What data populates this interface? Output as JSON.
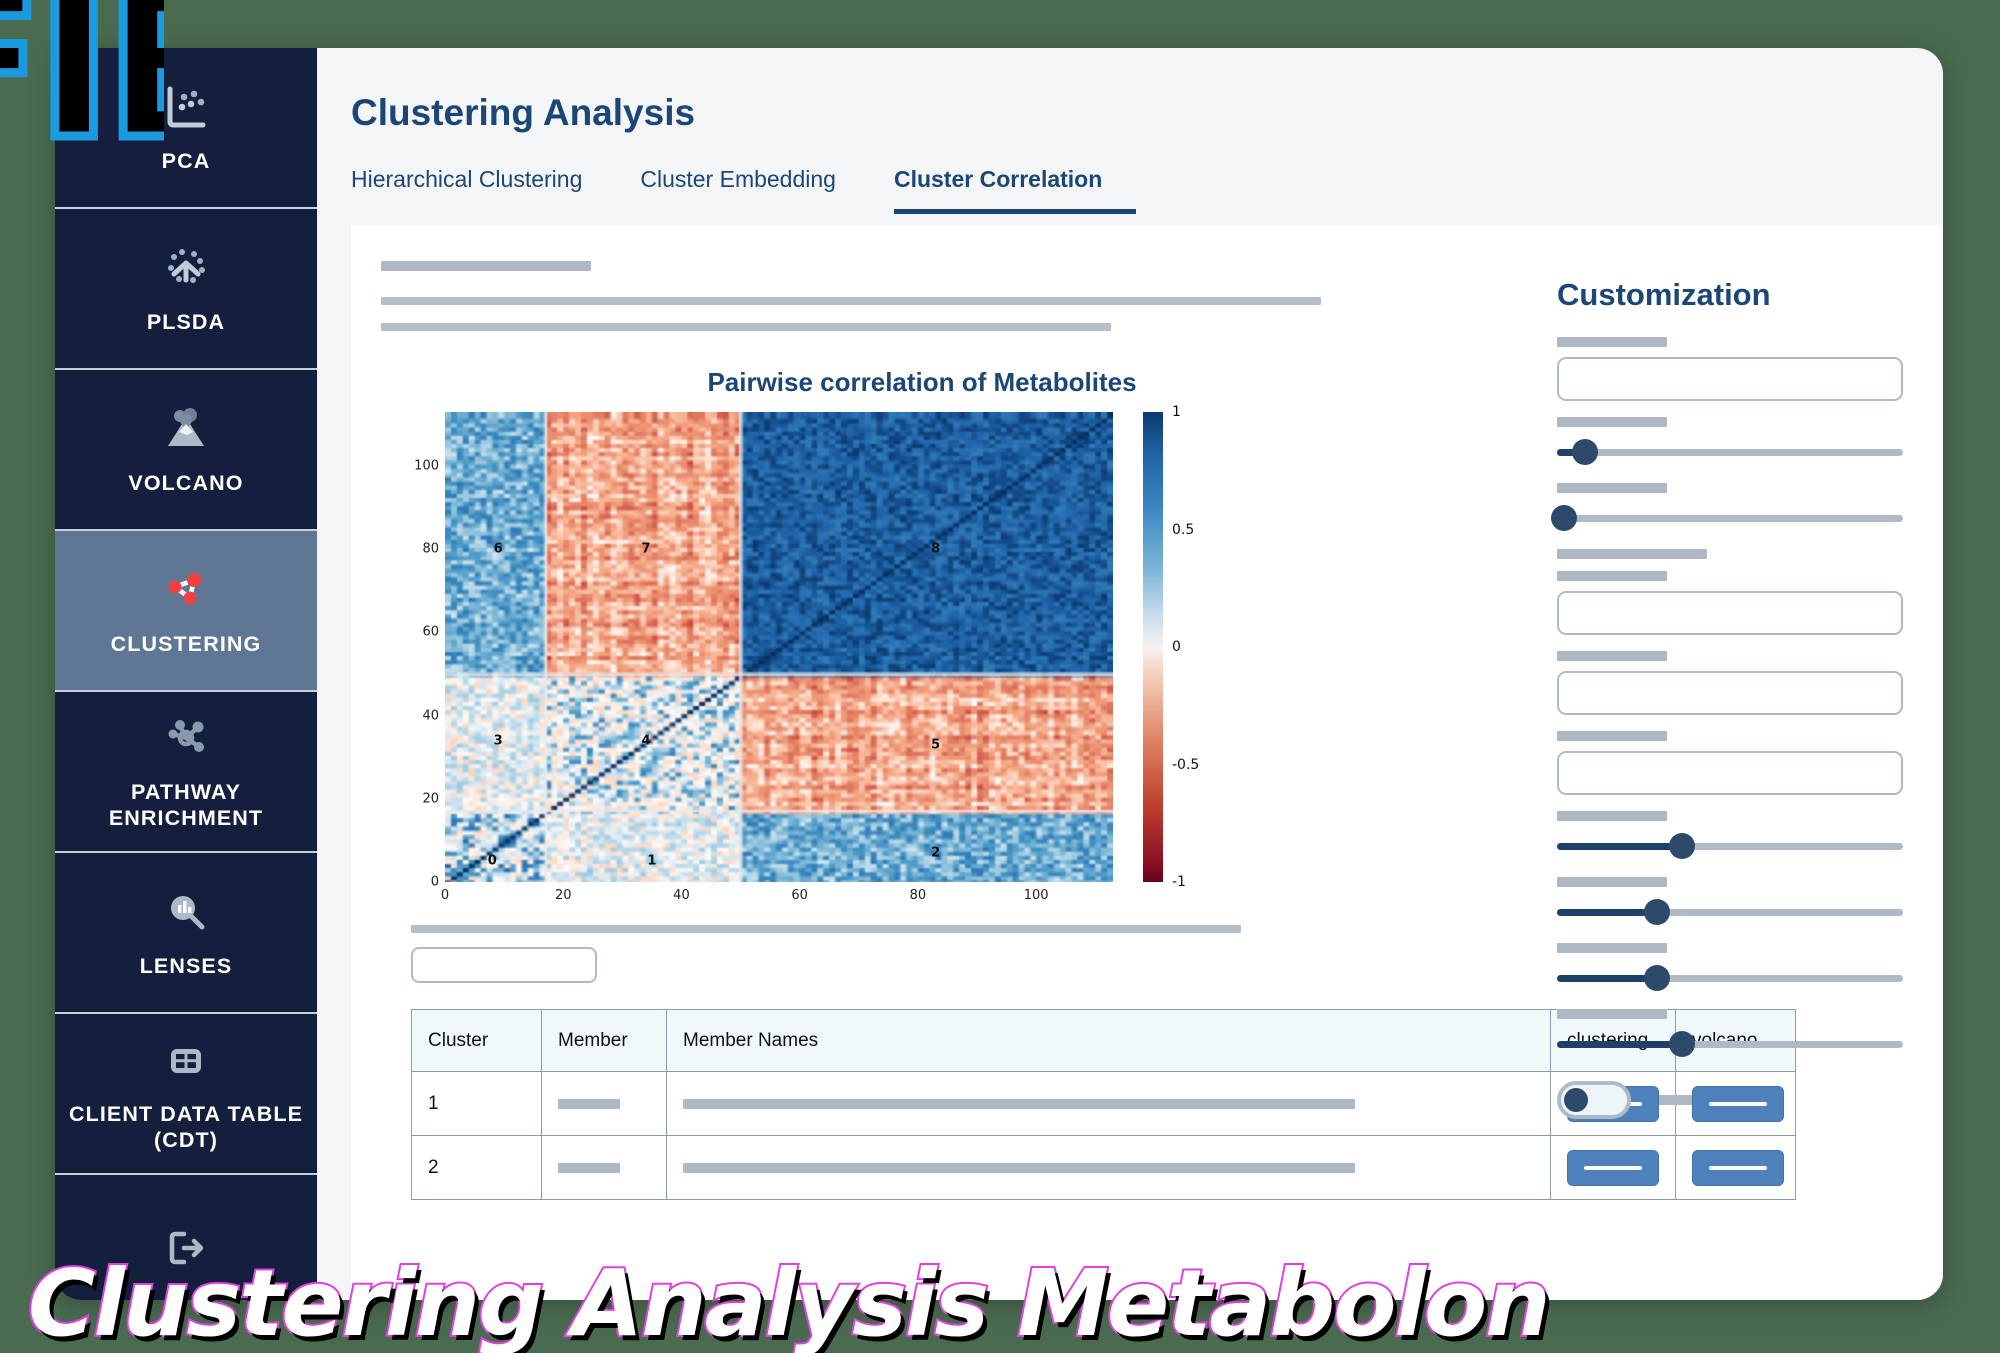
{
  "overlay": {
    "edge_text": "FIELD",
    "bottom_text": "Clustering Analysis Metabolon"
  },
  "sidebar": {
    "items": [
      {
        "label": "PCA",
        "icon": "pca-scatter-icon",
        "active": false
      },
      {
        "label": "PLSDA",
        "icon": "plsda-icon",
        "active": false
      },
      {
        "label": "VOLCANO",
        "icon": "volcano-icon",
        "active": false
      },
      {
        "label": "CLUSTERING",
        "icon": "clustering-network-icon",
        "active": true
      },
      {
        "label": "PATHWAY ENRICHMENT",
        "icon": "pathway-molecule-icon",
        "active": false
      },
      {
        "label": "LENSES",
        "icon": "lens-magnifier-icon",
        "active": false
      },
      {
        "label": "CLIENT DATA TABLE (CDT)",
        "icon": "table-grid-icon",
        "active": false
      },
      {
        "label": "",
        "icon": "logout-icon",
        "active": false
      }
    ]
  },
  "header": {
    "title": "Clustering Analysis"
  },
  "tabs": [
    {
      "label": "Hierarchical Clustering",
      "active": false
    },
    {
      "label": "Cluster Embedding",
      "active": false
    },
    {
      "label": "Cluster Correlation",
      "active": true
    }
  ],
  "customization": {
    "title": "Customization",
    "sliders": [
      {
        "name": "slider-1",
        "percent": 8
      },
      {
        "name": "slider-2",
        "percent": 2
      },
      {
        "name": "slider-3",
        "percent": 36
      },
      {
        "name": "slider-4",
        "percent": 29
      },
      {
        "name": "slider-5",
        "percent": 29
      },
      {
        "name": "slider-6",
        "percent": 36
      }
    ],
    "toggle_on": false
  },
  "chart_data": {
    "type": "heatmap",
    "title": "Pairwise correlation of Metabolites",
    "xlabel": "",
    "ylabel": "",
    "xlim": [
      0,
      113
    ],
    "ylim": [
      0,
      113
    ],
    "xticks": [
      0,
      20,
      40,
      60,
      80,
      100
    ],
    "yticks": [
      0,
      20,
      40,
      60,
      80,
      100
    ],
    "grid": false,
    "colorbar": {
      "label": "",
      "ticks": [
        "1",
        "0.5",
        "0",
        "-0.5",
        "-1"
      ],
      "vmin": -1,
      "vmax": 1,
      "colormap": "RdBu",
      "position": "right"
    },
    "cluster_labels": [
      {
        "id": "0",
        "x": 8,
        "y": 5
      },
      {
        "id": "1",
        "x": 35,
        "y": 5
      },
      {
        "id": "2",
        "x": 83,
        "y": 7
      },
      {
        "id": "3",
        "x": 9,
        "y": 34
      },
      {
        "id": "4",
        "x": 34,
        "y": 34
      },
      {
        "id": "5",
        "x": 83,
        "y": 33
      },
      {
        "id": "6",
        "x": 9,
        "y": 80
      },
      {
        "id": "7",
        "x": 34,
        "y": 80
      },
      {
        "id": "8",
        "x": 83,
        "y": 80
      }
    ],
    "cluster_blocks": [
      {
        "id": "0",
        "start": 0,
        "end": 17
      },
      {
        "id": "1",
        "start": 17,
        "end": 50
      },
      {
        "id": "2",
        "start": 50,
        "end": 113
      },
      {
        "id": "3",
        "start": 0,
        "end": 17
      },
      {
        "id": "4",
        "start": 17,
        "end": 50
      },
      {
        "id": "5",
        "start": 50,
        "end": 113
      }
    ],
    "block_correlations": [
      [
        1.0,
        0.05,
        0.35
      ],
      [
        0.05,
        0.1,
        0.25
      ],
      [
        0.35,
        0.25,
        0.8
      ]
    ]
  },
  "table": {
    "columns": [
      "Cluster",
      "Member",
      "Member Names",
      "clustering",
      "volcano"
    ],
    "rows": [
      {
        "cluster": "1",
        "member": "",
        "member_names": "",
        "clustering": "",
        "volcano": ""
      },
      {
        "cluster": "2",
        "member": "",
        "member_names": "",
        "clustering": "",
        "volcano": ""
      }
    ]
  },
  "colors": {
    "brand_navy": "#141f3d",
    "accent_blue": "#1c4675",
    "active_nav": "#5f7795",
    "placeholder_gray": "#aeb7c2",
    "button_blue": "#4f81bd",
    "heat_positive": "#0a3b70",
    "heat_negative": "#67001f"
  }
}
